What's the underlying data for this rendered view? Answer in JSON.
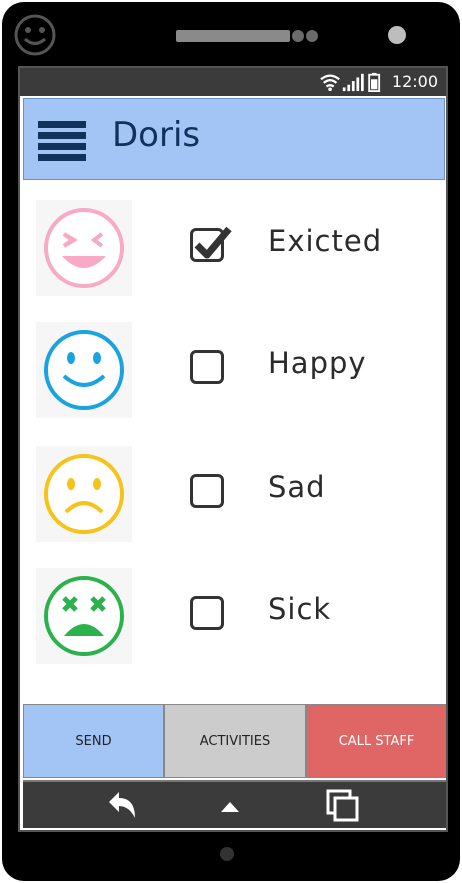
{
  "status_bar": {
    "time": "12:00",
    "icons": [
      "wifi-icon",
      "signal-icon",
      "battery-icon"
    ]
  },
  "app_bar": {
    "title": "Doris",
    "menu_icon": "hamburger-menu-icon"
  },
  "moods": [
    {
      "label": "Exicted",
      "checked": true,
      "icon": "excited-face-icon",
      "color": "#f7a9c6"
    },
    {
      "label": "Happy",
      "checked": false,
      "icon": "happy-face-icon",
      "color": "#1aa3e0"
    },
    {
      "label": "Sad",
      "checked": false,
      "icon": "sad-face-icon",
      "color": "#f7c21a"
    },
    {
      "label": "Sick",
      "checked": false,
      "icon": "sick-face-icon",
      "color": "#2bb24c"
    }
  ],
  "actions": {
    "send": "SEND",
    "activities": "ACTIVITIES",
    "call_staff": "CALL STAFF"
  },
  "colors": {
    "app_bar": "#a3c5f5",
    "send": "#a3c5f5",
    "activities": "#cccccc",
    "call_staff": "#e06666",
    "title": "#12325e"
  },
  "nav": {
    "icons": [
      "back-icon",
      "home-icon",
      "recent-apps-icon"
    ]
  }
}
